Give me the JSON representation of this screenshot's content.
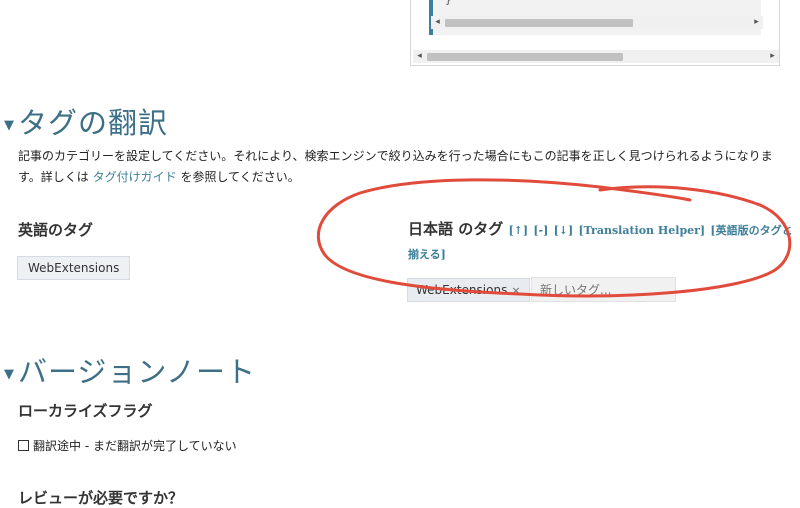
{
  "code_box": {
    "glyph": "}"
  },
  "tags_section": {
    "title": "タグの翻訳",
    "description_1": "記事のカテゴリーを設定してください。それにより、検索エンジンで絞り込みを行った場合にもこの記事を正しく見つけられるようになります。詳しくは",
    "description_link": "タグ付けガイド",
    "description_2": " を参照してください。",
    "english_heading": "英語のタグ",
    "english_tags": [
      "WebExtensions"
    ],
    "japanese_heading": "日本語 のタグ",
    "links": {
      "move_up": "[↑]",
      "remove": "[-]",
      "move_down": "[↓]",
      "translation_helper": "[Translation Helper]",
      "match_english": "[英語版のタグと揃える]"
    },
    "japanese_tags": [
      {
        "label": "WebExtensions",
        "remove": "×"
      }
    ],
    "new_tag_placeholder": "新しいタグ..."
  },
  "version_section": {
    "title": "バージョンノート",
    "localization_heading": "ローカライズフラグ",
    "checkbox_label": "翻訳途中 - まだ翻訳が完了していない",
    "checkbox_checked": false,
    "review_heading": "レビューが必要ですか？"
  },
  "annotation_color": "#e14b3b"
}
